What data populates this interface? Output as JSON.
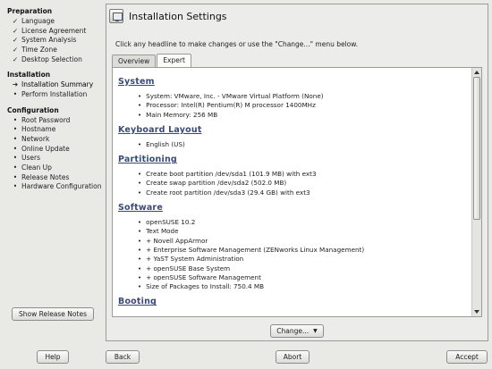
{
  "sidebar": {
    "sections": [
      {
        "heading": "Preparation",
        "items": [
          {
            "label": "Language",
            "mark": "✓"
          },
          {
            "label": "License Agreement",
            "mark": "✓"
          },
          {
            "label": "System Analysis",
            "mark": "✓"
          },
          {
            "label": "Time Zone",
            "mark": "✓"
          },
          {
            "label": "Desktop Selection",
            "mark": "✓"
          }
        ]
      },
      {
        "heading": "Installation",
        "items": [
          {
            "label": "Installation Summary",
            "mark": "➜"
          },
          {
            "label": "Perform Installation",
            "mark": "•"
          }
        ]
      },
      {
        "heading": "Configuration",
        "items": [
          {
            "label": "Root Password",
            "mark": "•"
          },
          {
            "label": "Hostname",
            "mark": "•"
          },
          {
            "label": "Network",
            "mark": "•"
          },
          {
            "label": "Online Update",
            "mark": "•"
          },
          {
            "label": "Users",
            "mark": "•"
          },
          {
            "label": "Clean Up",
            "mark": "•"
          },
          {
            "label": "Release Notes",
            "mark": "•"
          },
          {
            "label": "Hardware Configuration",
            "mark": "•"
          }
        ]
      }
    ],
    "release_notes_button": "Show Release Notes"
  },
  "main": {
    "title": "Installation Settings",
    "intro": "Click any headline to make changes or use the \"Change...\" menu below.",
    "tabs": [
      {
        "label": "Overview",
        "active": false
      },
      {
        "label": "Expert",
        "active": true
      }
    ],
    "sections": [
      {
        "title": "System",
        "items": [
          "System: VMware, Inc. - VMware Virtual Platform (None)",
          "Processor: Intel(R) Pentium(R) M processor 1400MHz",
          "Main Memory: 256 MB"
        ]
      },
      {
        "title": "Keyboard Layout",
        "items": [
          "English (US)"
        ]
      },
      {
        "title": "Partitioning",
        "items": [
          "Create boot partition /dev/sda1 (101.9 MB) with ext3",
          "Create swap partition /dev/sda2 (502.0 MB)",
          "Create root partition /dev/sda3 (29.4 GB) with ext3"
        ]
      },
      {
        "title": "Software",
        "items": [
          "openSUSE 10.2",
          "Text Mode",
          "+ Novell AppArmor",
          "+ Enterprise Software Management (ZENworks Linux Management)",
          "+ YaST System Administration",
          "+ openSUSE Base System",
          "+ openSUSE Software Management",
          "Size of Packages to Install: 750.4 MB"
        ]
      },
      {
        "title": "Booting",
        "items": []
      }
    ],
    "change_button": "Change...",
    "change_arrow": "▼"
  },
  "buttons": {
    "help": "Help",
    "back": "Back",
    "abort": "Abort",
    "accept": "Accept"
  },
  "colors": {
    "section_title": "#3a4a77",
    "background": "#e9e9e6",
    "content_background": "#ffffff"
  }
}
